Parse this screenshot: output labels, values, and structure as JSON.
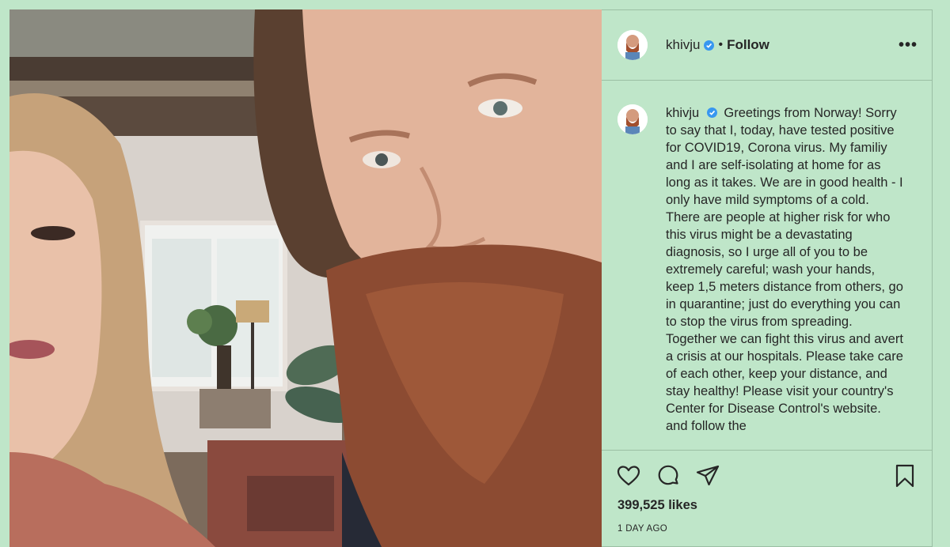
{
  "post": {
    "username": "khivju",
    "separator": "•",
    "follow_label": "Follow",
    "more_label": "•••",
    "caption_username": "khivju",
    "caption": "Greetings from Norway! Sorry to say that I, today, have tested positive for COVID19, Corona virus. My familiy and I are self-isolating at home for as long as it takes. We are in good health - I only have mild symptoms of a cold. There are people at higher risk for who this virus might be a devastating diagnosis, so I urge all of you to be extremely careful; wash your hands, keep 1,5 meters distance from others, go in quarantine; just do everything you can to stop the virus from spreading. Together we can fight this virus and avert a crisis at our hospitals. Please take care of each other, keep your distance, and stay healthy! Please visit your country's Center for Disease Control's website. and follow the",
    "likes": "399,525 likes",
    "timestamp": "1 DAY AGO"
  },
  "icons": {
    "verified": "verified-badge-icon",
    "like": "heart-icon",
    "comment": "comment-icon",
    "share": "share-icon",
    "save": "bookmark-icon"
  },
  "colors": {
    "background": "#bfe6c9",
    "verified_blue": "#3897f0",
    "text": "#262626"
  }
}
